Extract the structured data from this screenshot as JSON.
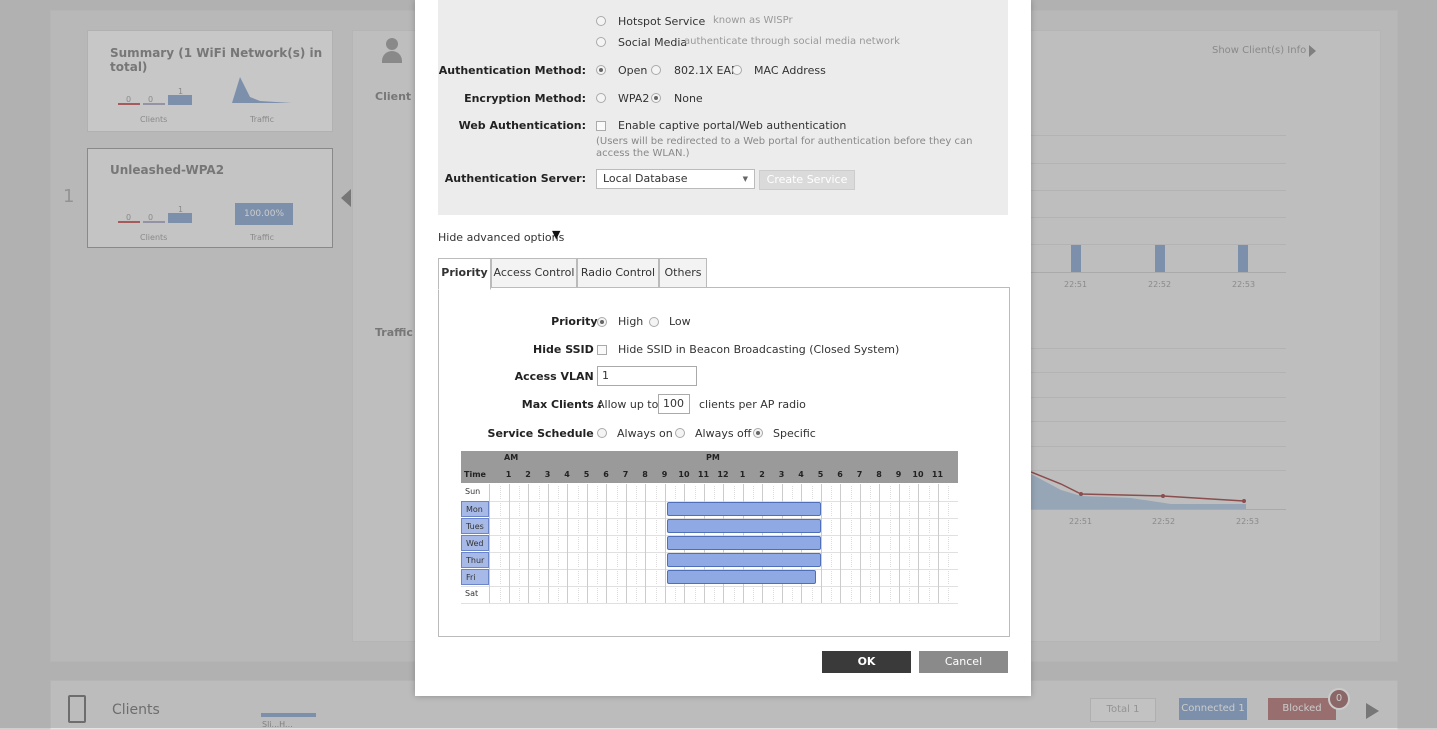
{
  "background": {
    "summary": {
      "title": "Summary (1 WiFi Network(s) in total)",
      "clients_label": "Clients",
      "traffic_label": "Traffic",
      "c1": "0",
      "c2": "0",
      "c3": "1"
    },
    "network_card": {
      "title": "Unleashed-WPA2",
      "clients_label": "Clients",
      "traffic_label": "Traffic",
      "traffic_value": "100.00%",
      "c1": "0",
      "c2": "0",
      "c3": "1"
    },
    "index": "1",
    "client_s": "Client S",
    "traffic": "Traffic",
    "show_info": "Show Client(s) Info",
    "times_top": [
      "22:51",
      "22:52",
      "22:53"
    ],
    "times_bottom": [
      "22:51",
      "22:52",
      "22:53"
    ],
    "footer": {
      "title": "Clients",
      "total": "Total 1",
      "connected": "Connected 1",
      "blocked": "Blocked",
      "blocked_count": "0"
    },
    "footer_overflow": "Sli...H..."
  },
  "modal": {
    "guest_options": [
      {
        "label": "Hotspot Service",
        "desc": "known as WISPr"
      },
      {
        "label": "Social Media",
        "desc": "authenticate through social media network"
      }
    ],
    "auth_method": {
      "label": "Authentication Method:",
      "options": [
        "Open",
        "802.1X EAP",
        "MAC Address"
      ],
      "selected": "Open"
    },
    "enc_method": {
      "label": "Encryption Method:",
      "options": [
        "WPA2",
        "None"
      ],
      "selected": "None"
    },
    "web_auth": {
      "label": "Web Authentication:",
      "option": "Enable captive portal/Web authentication",
      "note1": "(Users will be redirected to a Web portal for authentication before they can",
      "note2": "access the WLAN.)"
    },
    "auth_server": {
      "label": "Authentication Server:",
      "value": "Local Database",
      "create_label": "Create Service"
    },
    "advanced_toggle": "Hide advanced options",
    "tabs": [
      "Priority",
      "Access Control",
      "Radio Control",
      "Others"
    ],
    "priority": {
      "label": "Priority:",
      "options": [
        "High",
        "Low"
      ],
      "selected": "High"
    },
    "hide_ssid": {
      "label": "Hide SSID :",
      "option": "Hide SSID in Beacon Broadcasting (Closed System)"
    },
    "access_vlan": {
      "label": "Access VLAN :",
      "value": "1"
    },
    "max_clients": {
      "label": "Max Clients :",
      "prefix": "Allow up to",
      "value": "100",
      "suffix": "clients per AP radio"
    },
    "schedule": {
      "label": "Service Schedule :",
      "options": [
        "Always on",
        "Always off",
        "Specific"
      ],
      "selected": "Specific",
      "am_label": "AM",
      "pm_label": "PM",
      "time_label": "Time",
      "hours": [
        "1",
        "2",
        "3",
        "4",
        "5",
        "6",
        "7",
        "8",
        "9",
        "10",
        "11",
        "12",
        "1",
        "2",
        "3",
        "4",
        "5",
        "6",
        "7",
        "8",
        "9",
        "10",
        "11"
      ],
      "days": [
        "Sun",
        "Mon",
        "Tues",
        "Wed",
        "Thur",
        "Fri",
        "Sat"
      ],
      "active": {
        "Mon": [
          9,
          17
        ],
        "Tues": [
          9,
          17
        ],
        "Wed": [
          9,
          17
        ],
        "Thur": [
          9,
          17
        ],
        "Fri": [
          9,
          16.75
        ]
      }
    },
    "ok_label": "OK",
    "cancel_label": "Cancel"
  }
}
